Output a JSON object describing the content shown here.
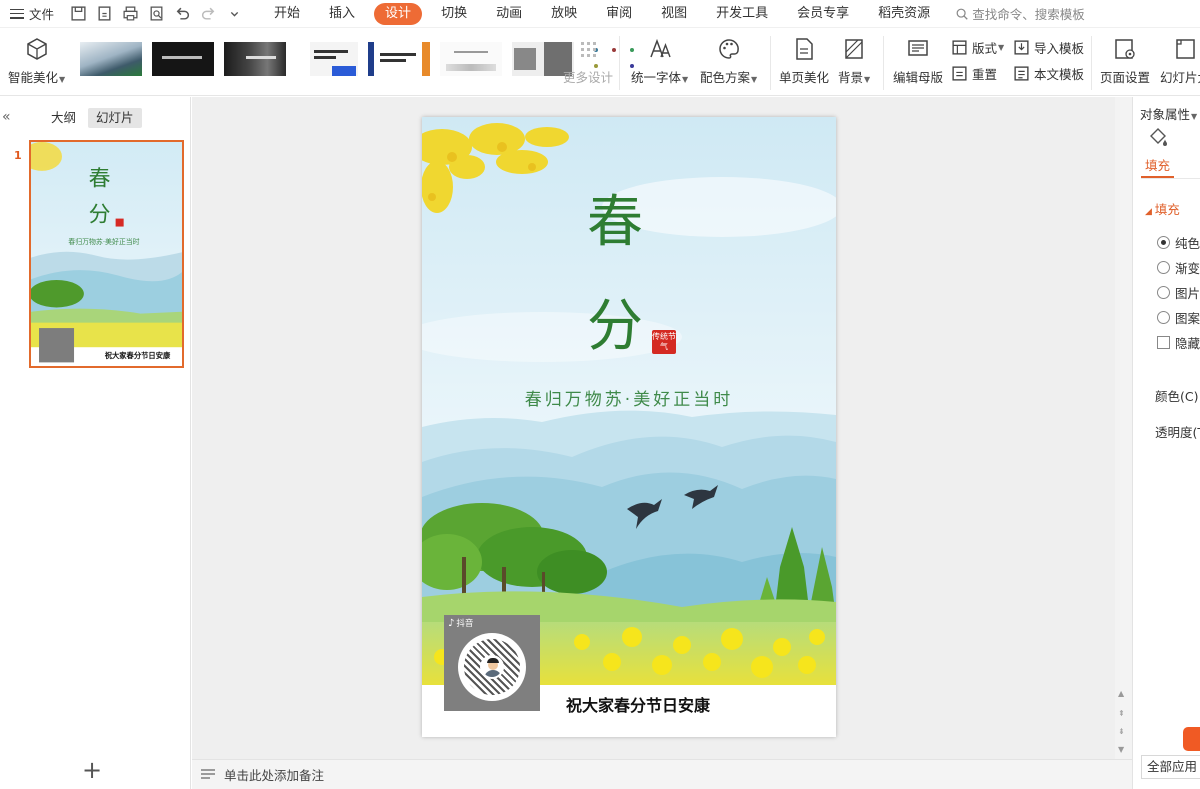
{
  "menubar": {
    "file": "文件",
    "tabs": [
      "开始",
      "插入",
      "设计",
      "切换",
      "动画",
      "放映",
      "审阅",
      "视图",
      "开发工具",
      "会员专享",
      "稻壳资源"
    ],
    "active_tab": "设计",
    "search_placeholder": "查找命令、搜索模板"
  },
  "ribbon": {
    "smart_beautify": "智能美化",
    "more_design": "更多设计",
    "unify_font": "统一字体",
    "color_scheme": "配色方案",
    "single_page_beautify": "单页美化",
    "background": "背景",
    "edit_master": "编辑母版",
    "layout": "版式",
    "reset": "重置",
    "import_template": "导入模板",
    "text_template": "本文模板",
    "page_setup": "页面设置",
    "slide_size": "幻灯片大"
  },
  "left_panel": {
    "tab_outline": "大纲",
    "tab_slides": "幻灯片",
    "slide_number": "1"
  },
  "slide": {
    "title_char_1": "春",
    "title_char_2": "分",
    "seal_text": "传统节气",
    "subtitle": "春归万物苏·美好正当时",
    "qr_app_label": "抖音",
    "footer_text": "祝大家春分节日安康"
  },
  "notes": {
    "placeholder": "单击此处添加备注"
  },
  "right_panel": {
    "title": "对象属性",
    "tab_fill": "填充",
    "section_fill": "填充",
    "options": [
      "纯色填充",
      "渐变填充",
      "图片或纹理填充",
      "图案填充"
    ],
    "selected_option": "纯色填充",
    "hide_bg": "隐藏背景图形",
    "color_label": "颜色(C)",
    "transparency_label": "透明度(T)",
    "apply_all": "全部应用"
  },
  "colors": {
    "accent_orange": "#ee6b35",
    "title_green": "#2e7d32",
    "subtitle_green": "#3f8a4a"
  }
}
